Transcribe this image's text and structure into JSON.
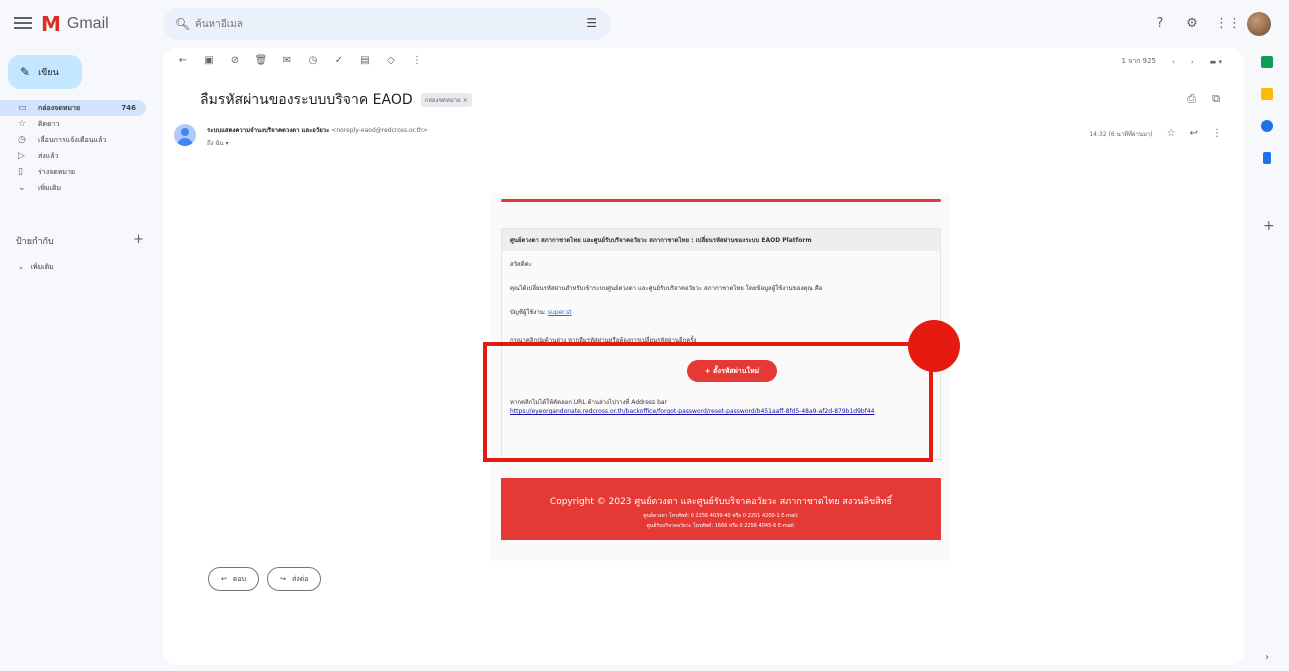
{
  "app": {
    "logo_letter": "M",
    "name": "Gmail"
  },
  "search": {
    "placeholder": "ค้นหาอีเมล"
  },
  "compose": {
    "label": "เขียน"
  },
  "sidebar": {
    "items": [
      {
        "label": "กล่องจดหมาย",
        "count": "746",
        "icon": "inbox-icon"
      },
      {
        "label": "ติดดาว",
        "icon": "star-icon"
      },
      {
        "label": "เลื่อนการแจ้งเตือนแล้ว",
        "icon": "clock-icon"
      },
      {
        "label": "ส่งแล้ว",
        "icon": "send-icon"
      },
      {
        "label": "ร่างจดหมาย",
        "icon": "draft-icon"
      },
      {
        "label": "เพิ่มเติม",
        "icon": "chevron-down-icon"
      }
    ],
    "labels_title": "ป้ายกำกับ",
    "labels_more": "เพิ่มเติม"
  },
  "toolbar": {
    "pagination": "1 จาก 925"
  },
  "email": {
    "subject": "ลืมรหัสผ่านของระบบบริจาค EAOD",
    "subject_chip": "กล่องจดหมาย ×",
    "sender_name": "ระบบแสดงความจำนงบริจาคดวงตา และอวัยวะ",
    "sender_email": "<noreply-eaod@redcross.or.th>",
    "to_me": "ถึง ฉัน ▾",
    "time": "14:32 (6 นาทีที่ผ่านมา)",
    "body": {
      "header": "ศูนย์ดวงตา สภากาชาดไทย และศูนย์รับบริจาคอวัยวะ สภากาชาดไทย : เปลี่ยนรหัสผ่านของระบบ EAOD Platform",
      "greeting": "สวัสดีค่ะ",
      "line1": "คุณได้เปลี่ยนรหัสผ่านสำหรับเข้าระบบศูนย์ดวงตา และศูนย์รับบริจาคอวัยวะ สภากาชาดไทย โดยข้อมูลผู้ใช้งานของคุณ คือ",
      "account_label": "บัญชีผู้ใช้งาน:",
      "account_value": "super.st",
      "instruction": "กรุณาคลิกปุ่มด้านล่าง หากลืมรหัสผ่านหรือต้องการเปลี่ยนรหัสผ่านอีกครั้ง",
      "button": "+ ตั้งรหัสผ่านใหม่",
      "link_label": "หากคลิกไม่ได้ให้คัดลอก URL ด้านล่างไปวางที่ Address bar",
      "link_url": "https://eyeorgandonate.redcross.or.th/backoffice/forgot-password/reset-password/b451aaff-8fd5-48a9-af2d-879b1d9bf44",
      "copyright": "Copyright © 2023 ศูนย์ดวงตา และศูนย์รับบริจาคอวัยวะ สภากาชาดไทย สงวนลิขสิทธิ์",
      "footer_line1": "ศูนย์ดวงตา โทรศัพท์: 0 2256 4039-40 หรือ 0 2251 4200-1 E-mail:",
      "footer_line2": "ศูนย์รับบริจาคอวัยวะ โทรศัพท์: 1666 หรือ 0 2256 4045-6 E-mail:"
    }
  },
  "reply": {
    "reply_label": "ตอบ",
    "forward_label": "ส่งต่อ"
  },
  "colors": {
    "accent_red": "#e53935",
    "annotation_red": "#e51a10"
  }
}
